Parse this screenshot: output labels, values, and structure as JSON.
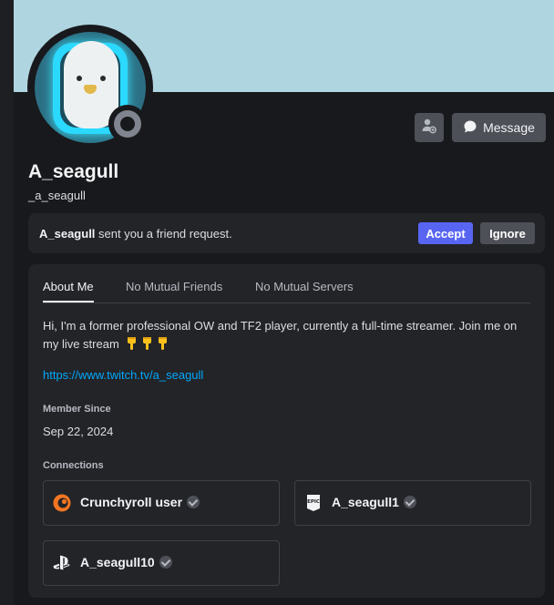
{
  "profile": {
    "display_name": "A_seagull",
    "username": "_a_seagull",
    "message_label": "Message"
  },
  "friend_request": {
    "name": "A_seagull",
    "text": " sent you a friend request.",
    "accept_label": "Accept",
    "ignore_label": "Ignore"
  },
  "tabs": [
    "About Me",
    "No Mutual Friends",
    "No Mutual Servers"
  ],
  "about": {
    "bio": "Hi, I'm a former professional OW and TF2 player, currently a full-time streamer. Join me on my live stream",
    "link": "https://www.twitch.tv/a_seagull",
    "member_since_label": "Member Since",
    "member_since": "Sep 22, 2024",
    "connections_label": "Connections"
  },
  "connections": [
    {
      "name": "Crunchyroll user",
      "icon": "crunchyroll-icon"
    },
    {
      "name": "A_seagull1",
      "icon": "epic-games-icon"
    },
    {
      "name": "A_seagull10",
      "icon": "playstation-icon"
    }
  ],
  "colors": {
    "banner": "#afd5e0",
    "accept": "#5865f2",
    "link": "#00a8fc",
    "status_offline": "#80848e"
  }
}
